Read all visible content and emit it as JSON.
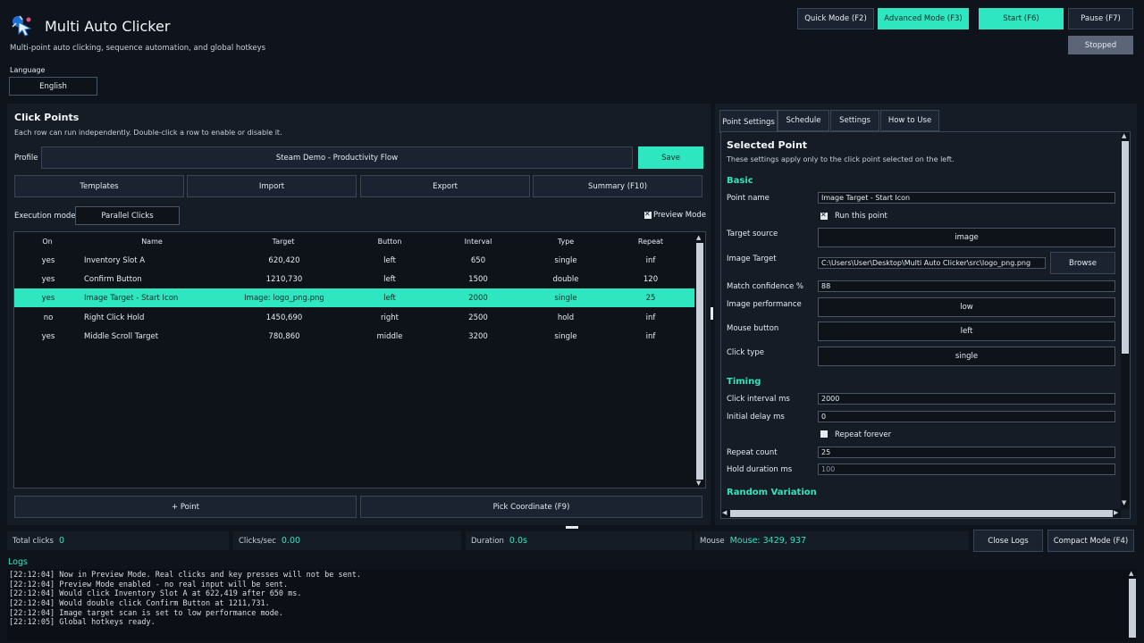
{
  "app": {
    "title": "Multi Auto Clicker",
    "subtitle": "Multi-point auto clicking, sequence automation, and global hotkeys",
    "icon": "cursor-click-icon"
  },
  "header_buttons": {
    "quick_mode": "Quick Mode (F2)",
    "advanced_mode": "Advanced Mode (F3)",
    "start": "Start (F6)",
    "pause": "Pause (F7)",
    "status": "Stopped"
  },
  "language": {
    "label": "Language",
    "value": "English"
  },
  "click_points": {
    "title": "Click Points",
    "description": "Each row can run independently. Double-click a row to enable or disable it.",
    "profile_label": "Profile",
    "profile_value": "Steam Demo - Productivity Flow",
    "save": "Save",
    "templates": "Templates",
    "import": "Import",
    "export": "Export",
    "summary": "Summary (F10)",
    "execution_mode_label": "Execution mode",
    "execution_mode_value": "Parallel Clicks",
    "preview_mode": "Preview Mode",
    "columns": [
      "On",
      "Name",
      "Target",
      "Button",
      "Interval",
      "Type",
      "Repeat"
    ],
    "rows": [
      {
        "on": "yes",
        "name": "Inventory Slot A",
        "target": "620,420",
        "button": "left",
        "interval": "650",
        "type": "single",
        "repeat": "inf"
      },
      {
        "on": "yes",
        "name": "Confirm Button",
        "target": "1210,730",
        "button": "left",
        "interval": "1500",
        "type": "double",
        "repeat": "120"
      },
      {
        "on": "yes",
        "name": "Image Target - Start Icon",
        "target": "Image: logo_png.png",
        "button": "left",
        "interval": "2000",
        "type": "single",
        "repeat": "25"
      },
      {
        "on": "no",
        "name": "Right Click Hold",
        "target": "1450,690",
        "button": "right",
        "interval": "2500",
        "type": "hold",
        "repeat": "inf"
      },
      {
        "on": "yes",
        "name": "Middle Scroll Target",
        "target": "780,860",
        "button": "middle",
        "interval": "3200",
        "type": "single",
        "repeat": "inf"
      }
    ],
    "add_point": "+ Point",
    "pick_coordinate": "Pick Coordinate (F9)"
  },
  "tabs": [
    "Point Settings",
    "Schedule",
    "Settings",
    "How to Use"
  ],
  "selected_point": {
    "title": "Selected Point",
    "description": "These settings apply only to the click point selected on the left.",
    "basic_title": "Basic",
    "point_name_label": "Point name",
    "point_name_value": "Image Target - Start Icon",
    "run_this_point": "Run this point",
    "target_source_label": "Target source",
    "target_source_value": "image",
    "image_target_label": "Image Target",
    "image_target_value": "C:\\Users\\User\\Desktop\\Multi Auto Clicker\\src\\logo_png.png",
    "browse": "Browse",
    "match_confidence_label": "Match confidence %",
    "match_confidence_value": "88",
    "image_performance_label": "Image performance",
    "image_performance_value": "low",
    "mouse_button_label": "Mouse button",
    "mouse_button_value": "left",
    "click_type_label": "Click type",
    "click_type_value": "single",
    "timing_title": "Timing",
    "click_interval_label": "Click interval ms",
    "click_interval_value": "2000",
    "initial_delay_label": "Initial delay ms",
    "initial_delay_value": "0",
    "repeat_forever": "Repeat forever",
    "repeat_count_label": "Repeat count",
    "repeat_count_value": "25",
    "hold_duration_label": "Hold duration ms",
    "hold_duration_value": "100",
    "random_variation_title": "Random Variation"
  },
  "stats": {
    "total_clicks_label": "Total clicks",
    "total_clicks_value": "0",
    "clicks_sec_label": "Clicks/sec",
    "clicks_sec_value": "0.00",
    "duration_label": "Duration",
    "duration_value": "0.0s",
    "mouse_label": "Mouse",
    "mouse_value": "Mouse: 3429, 937",
    "close_logs": "Close Logs",
    "compact_mode": "Compact Mode (F4)"
  },
  "logs": {
    "title": "Logs",
    "lines": [
      "[22:12:04] Now in Preview Mode. Real clicks and key presses will not be sent.",
      "[22:12:04] Preview Mode enabled - no real input will be sent.",
      "[22:12:04] Would click Inventory Slot A at 622,419 after 650 ms.",
      "[22:12:04] Would double click Confirm Button at 1211,731.",
      "[22:12:04] Image target scan is set to low performance mode.",
      "[22:12:05] Global hotkeys ready."
    ]
  },
  "colors": {
    "accent": "#2ee6c0",
    "background": "#0f141c",
    "panel": "#161c26"
  }
}
